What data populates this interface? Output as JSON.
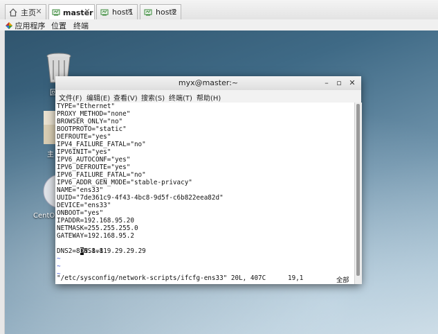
{
  "tabs": [
    {
      "label": "主页",
      "icon": "home-icon",
      "active": false
    },
    {
      "label": "master",
      "icon": "vm-icon",
      "active": true
    },
    {
      "label": "host1",
      "icon": "vm-icon",
      "active": false
    },
    {
      "label": "host2",
      "icon": "vm-icon",
      "active": false
    }
  ],
  "menubar": {
    "applications": "应用程序",
    "places": "位置",
    "terminal": "终端"
  },
  "desktop": {
    "trash_label": "回",
    "home_label": "主",
    "dvd_label": "CentOS"
  },
  "terminal": {
    "title": "myx@master:~",
    "menu": [
      "文件(F)",
      "编辑(E)",
      "查看(V)",
      "搜索(S)",
      "终端(T)",
      "帮助(H)"
    ],
    "lines": [
      "TYPE=\"Ethernet\"",
      "PROXY_METHOD=\"none\"",
      "BROWSER_ONLY=\"no\"",
      "BOOTPROTO=\"static\"",
      "DEFROUTE=\"yes\"",
      "IPV4_FAILURE_FATAL=\"no\"",
      "IPV6INIT=\"yes\"",
      "IPV6_AUTOCONF=\"yes\"",
      "IPV6_DEFROUTE=\"yes\"",
      "IPV6_FAILURE_FATAL=\"no\"",
      "IPV6_ADDR_GEN_MODE=\"stable-privacy\"",
      "NAME=\"ens33\"",
      "UUID=\"7de361c9-4f43-4bc8-9d5f-c6b822eea82d\"",
      "DEVICE=\"ens33\"",
      "ONBOOT=\"yes\"",
      "IPADDR=192.168.95.20",
      "NETMASK=255.255.255.0",
      "GATEWAY=192.168.95.2",
      "DNS1=119.29.29.29",
      "DNS2=8.8.8.8"
    ],
    "tildes": [
      "~",
      "~",
      "~"
    ],
    "status_file": "\"/etc/sysconfig/network-scripts/ifcfg-ens33\" 20L, 407C",
    "status_pos": "19,1",
    "status_all": "全部"
  },
  "colors": {
    "tilde": "#3a4fd0",
    "desktop_top": "#30556e",
    "desktop_bottom": "#c9d9e3"
  }
}
